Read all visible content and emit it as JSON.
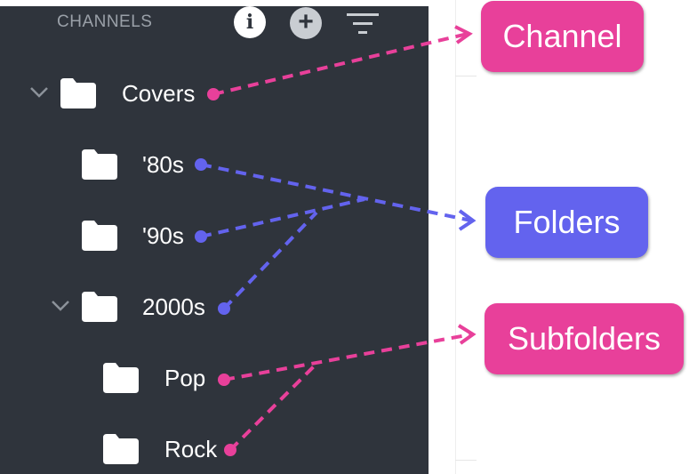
{
  "sidebar": {
    "header_title": "CHANNELS",
    "info_glyph": "i",
    "add_glyph": "+",
    "items": [
      {
        "label": "Covers",
        "icon": "folder-icon",
        "expanded": true,
        "has_chevron": true
      },
      {
        "label": "'80s",
        "icon": "folder-icon",
        "has_chevron": false
      },
      {
        "label": "'90s",
        "icon": "folder-icon",
        "has_chevron": false
      },
      {
        "label": "2000s",
        "icon": "folder-icon",
        "expanded": true,
        "has_chevron": true
      },
      {
        "label": "Pop",
        "icon": "folder-icon",
        "has_chevron": false
      },
      {
        "label": "Rock",
        "icon": "folder-icon",
        "has_chevron": false
      }
    ]
  },
  "callouts": {
    "channel": {
      "label": "Channel",
      "color": "#e8409a"
    },
    "folders": {
      "label": "Folders",
      "color": "#6363ee"
    },
    "subfolders": {
      "label": "Subfolders",
      "color": "#e8409a"
    }
  },
  "colors": {
    "sidebar_bg": "#2f343c",
    "pink_connector": "#e8409a",
    "blue_connector": "#6363ee"
  }
}
